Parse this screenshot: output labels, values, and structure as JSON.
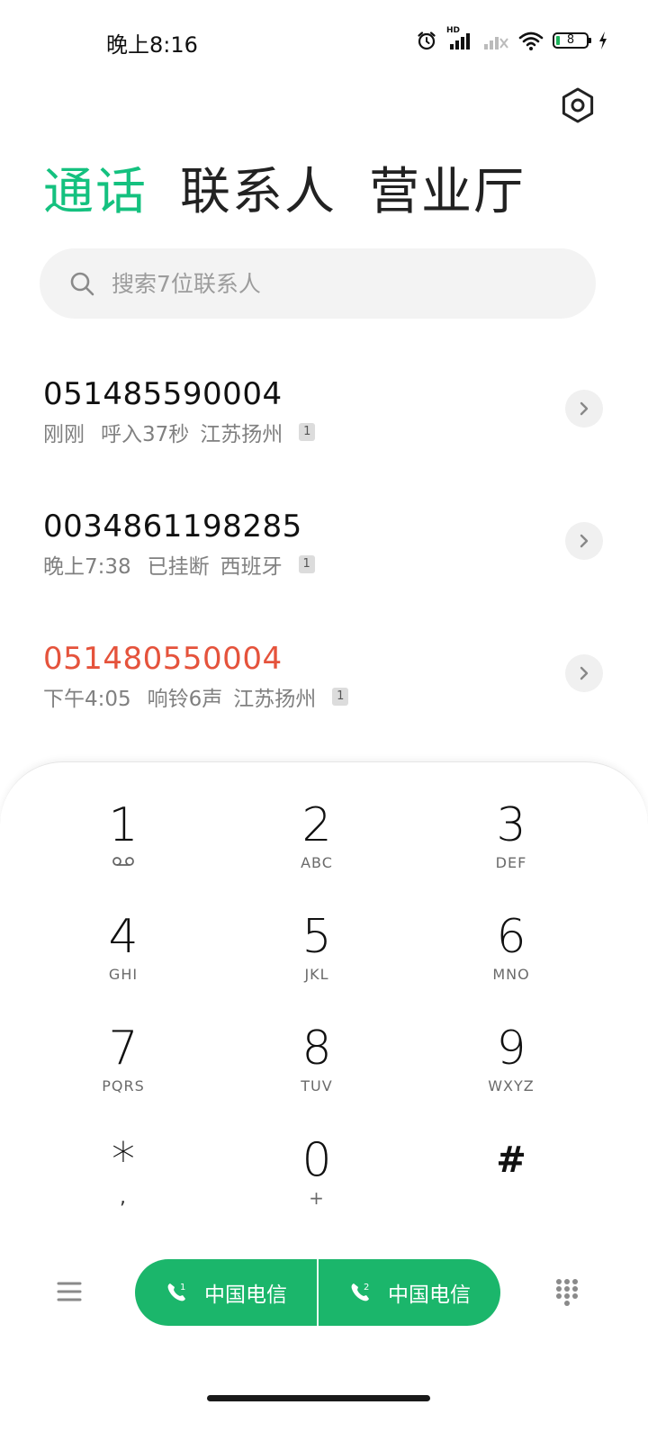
{
  "status_bar": {
    "time": "晚上8:16",
    "battery_level": "8",
    "hd_label": "HD"
  },
  "tabs": [
    {
      "label": "通话",
      "active": true
    },
    {
      "label": "联系人",
      "active": false
    },
    {
      "label": "营业厅",
      "active": false
    }
  ],
  "search": {
    "placeholder": "搜索7位联系人"
  },
  "calls": [
    {
      "number": "051485590004",
      "time": "刚刚",
      "status": "呼入37秒",
      "location": "江苏扬州",
      "sim": "1",
      "missed": false
    },
    {
      "number": "0034861198285",
      "time": "晚上7:38",
      "status": "已挂断",
      "location": "西班牙",
      "sim": "1",
      "missed": false
    },
    {
      "number": "051480550004",
      "time": "下午4:05",
      "status": "响铃6声",
      "location": "江苏扬州",
      "sim": "1",
      "missed": true
    }
  ],
  "keys": [
    {
      "digit": "1",
      "letters": ""
    },
    {
      "digit": "2",
      "letters": "ABC"
    },
    {
      "digit": "3",
      "letters": "DEF"
    },
    {
      "digit": "4",
      "letters": "GHI"
    },
    {
      "digit": "5",
      "letters": "JKL"
    },
    {
      "digit": "6",
      "letters": "MNO"
    },
    {
      "digit": "7",
      "letters": "PQRS"
    },
    {
      "digit": "8",
      "letters": "TUV"
    },
    {
      "digit": "9",
      "letters": "WXYZ"
    },
    {
      "digit": "*",
      "letters": ","
    },
    {
      "digit": "0",
      "letters": "+"
    },
    {
      "digit": "#",
      "letters": ""
    }
  ],
  "call_buttons": [
    {
      "sim": "1",
      "carrier": "中国电信"
    },
    {
      "sim": "2",
      "carrier": "中国电信"
    }
  ],
  "colors": {
    "accent": "#14c17f",
    "missed": "#e5533c",
    "call_button": "#1bb66b"
  }
}
